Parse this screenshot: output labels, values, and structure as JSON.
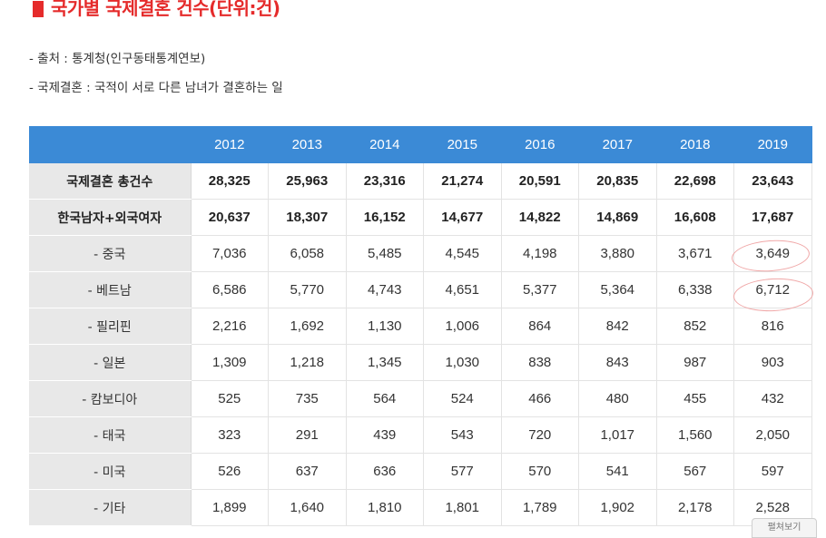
{
  "heading": {
    "title": "국가별 국제결혼 건수(단위:건)"
  },
  "notes": [
    "- 출처 : 통계청(인구동태통계연보)",
    "- 국제결혼 : 국적이 서로 다른 남녀가 결혼하는 일"
  ],
  "table": {
    "years": [
      "2012",
      "2013",
      "2014",
      "2015",
      "2016",
      "2017",
      "2018",
      "2019"
    ],
    "rows": [
      {
        "label": "국제결혼 총건수",
        "values": [
          "28,325",
          "25,963",
          "23,316",
          "21,274",
          "20,591",
          "20,835",
          "22,698",
          "23,643"
        ]
      },
      {
        "label": "한국남자+외국여자",
        "values": [
          "20,637",
          "18,307",
          "16,152",
          "14,677",
          "14,822",
          "14,869",
          "16,608",
          "17,687"
        ]
      },
      {
        "label": "- 중국",
        "values": [
          "7,036",
          "6,058",
          "5,485",
          "4,545",
          "4,198",
          "3,880",
          "3,671",
          "3,649"
        ]
      },
      {
        "label": "- 베트남",
        "values": [
          "6,586",
          "5,770",
          "4,743",
          "4,651",
          "5,377",
          "5,364",
          "6,338",
          "6,712"
        ]
      },
      {
        "label": "- 필리핀",
        "values": [
          "2,216",
          "1,692",
          "1,130",
          "1,006",
          "864",
          "842",
          "852",
          "816"
        ]
      },
      {
        "label": "- 일본",
        "values": [
          "1,309",
          "1,218",
          "1,345",
          "1,030",
          "838",
          "843",
          "987",
          "903"
        ]
      },
      {
        "label": "- 캄보디아",
        "values": [
          "525",
          "735",
          "564",
          "524",
          "466",
          "480",
          "455",
          "432"
        ]
      },
      {
        "label": "- 태국",
        "values": [
          "323",
          "291",
          "439",
          "543",
          "720",
          "1,017",
          "1,560",
          "2,050"
        ]
      },
      {
        "label": "- 미국",
        "values": [
          "526",
          "637",
          "636",
          "577",
          "570",
          "541",
          "567",
          "597"
        ]
      },
      {
        "label": "- 기타",
        "values": [
          "1,899",
          "1,640",
          "1,810",
          "1,801",
          "1,789",
          "1,902",
          "2,178",
          "2,528"
        ]
      }
    ]
  },
  "corner_tab": {
    "label": "펼쳐보기"
  },
  "colors": {
    "accent": "#e52b2b",
    "header": "#3b8ad6",
    "label_bg": "#e8e8e8",
    "highlight": "#f0a8a8"
  }
}
